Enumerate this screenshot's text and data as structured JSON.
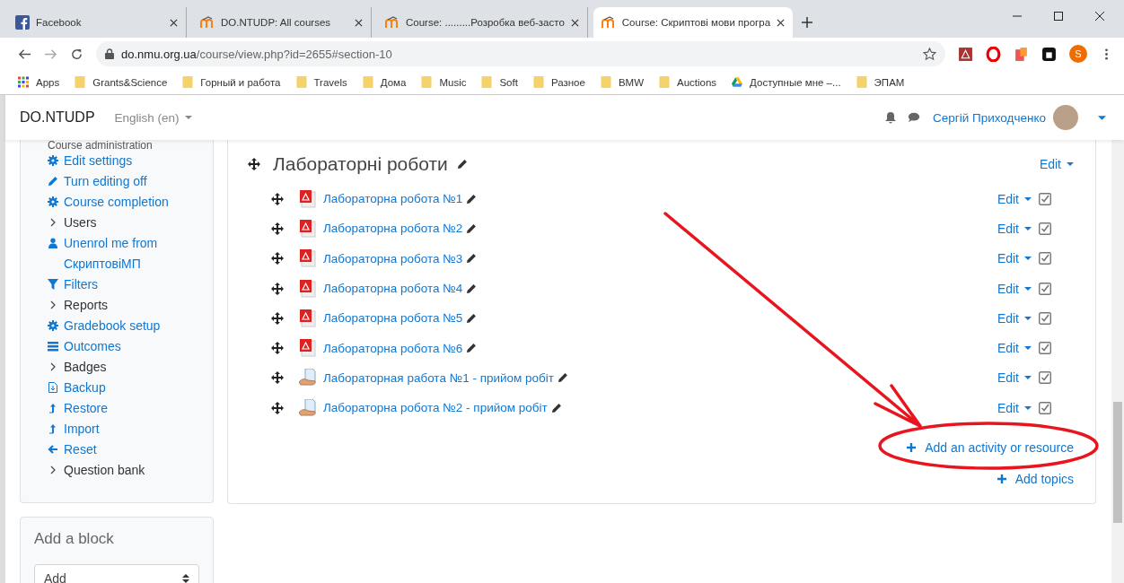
{
  "browser": {
    "tabs": [
      {
        "title": "Facebook",
        "kind": "facebook",
        "selected": false
      },
      {
        "title": "DO.NTUDP: All courses",
        "kind": "moodle",
        "selected": false
      },
      {
        "title": "Course: .........Розробка веб-засто",
        "kind": "moodle",
        "selected": false
      },
      {
        "title": "Course: Скриптові мови програ",
        "kind": "moodle",
        "selected": true
      }
    ],
    "url_host": "do.nmu.org.ua",
    "url_path": "/course/view.php?id=2655#section-10",
    "profile_initial": "S",
    "bookmarks": [
      {
        "label": "Apps",
        "kind": "apps"
      },
      {
        "label": "Grants&Science",
        "kind": "folder"
      },
      {
        "label": "Горный и работа",
        "kind": "folder"
      },
      {
        "label": "Travels",
        "kind": "folder"
      },
      {
        "label": "Дома",
        "kind": "folder"
      },
      {
        "label": "Music",
        "kind": "folder"
      },
      {
        "label": "Soft",
        "kind": "folder"
      },
      {
        "label": "Разное",
        "kind": "folder"
      },
      {
        "label": "BMW",
        "kind": "folder"
      },
      {
        "label": "Auctions",
        "kind": "folder"
      },
      {
        "label": "Доступные мне –...",
        "kind": "drive"
      },
      {
        "label": "ЭПАМ",
        "kind": "folder"
      }
    ]
  },
  "navbar": {
    "brand": "DO.NTUDP",
    "language": "English (en)",
    "user": "Сергій Приходченко"
  },
  "sidebar": {
    "heading": "Course administration",
    "items": [
      {
        "label": "Edit settings",
        "kind": "gear"
      },
      {
        "label": "Turn editing off",
        "kind": "pencil"
      },
      {
        "label": "Course completion",
        "kind": "gear"
      },
      {
        "label": "Users",
        "kind": "chevron"
      },
      {
        "label": "Unenrol me from СкриптовіМП",
        "kind": "user"
      },
      {
        "label": "Filters",
        "kind": "filter"
      },
      {
        "label": "Reports",
        "kind": "chevron"
      },
      {
        "label": "Gradebook setup",
        "kind": "gear"
      },
      {
        "label": "Outcomes",
        "kind": "list"
      },
      {
        "label": "Badges",
        "kind": "chevron"
      },
      {
        "label": "Backup",
        "kind": "backup"
      },
      {
        "label": "Restore",
        "kind": "upload"
      },
      {
        "label": "Import",
        "kind": "upload"
      },
      {
        "label": "Reset",
        "kind": "back"
      },
      {
        "label": "Question bank",
        "kind": "chevron"
      }
    ]
  },
  "add_block": {
    "title": "Add a block",
    "select_value": "Add"
  },
  "section": {
    "title": "Лабораторні роботи",
    "edit": "Edit",
    "activities": [
      {
        "name": "Лабораторна робота №1",
        "kind": "pdf",
        "edit": "Edit",
        "visible": true
      },
      {
        "name": "Лабораторна робота №2",
        "kind": "pdf",
        "edit": "Edit",
        "visible": true
      },
      {
        "name": "Лабораторна робота №3",
        "kind": "pdf",
        "edit": "Edit",
        "visible": true
      },
      {
        "name": "Лабораторна робота №4",
        "kind": "pdf",
        "edit": "Edit",
        "visible": true
      },
      {
        "name": "Лабораторна робота №5",
        "kind": "pdf",
        "edit": "Edit",
        "visible": true
      },
      {
        "name": "Лабораторна робота №6",
        "kind": "pdf",
        "edit": "Edit",
        "visible": true
      },
      {
        "name": "Лабораторная работа №1 - прийом робіт",
        "kind": "assignment",
        "edit": "Edit",
        "visible": true
      },
      {
        "name": "Лабораторна робота №2 - прийом робіт",
        "kind": "assignment",
        "edit": "Edit",
        "visible": true
      }
    ],
    "add_activity": "Add an activity or resource",
    "add_topics": "Add topics"
  }
}
